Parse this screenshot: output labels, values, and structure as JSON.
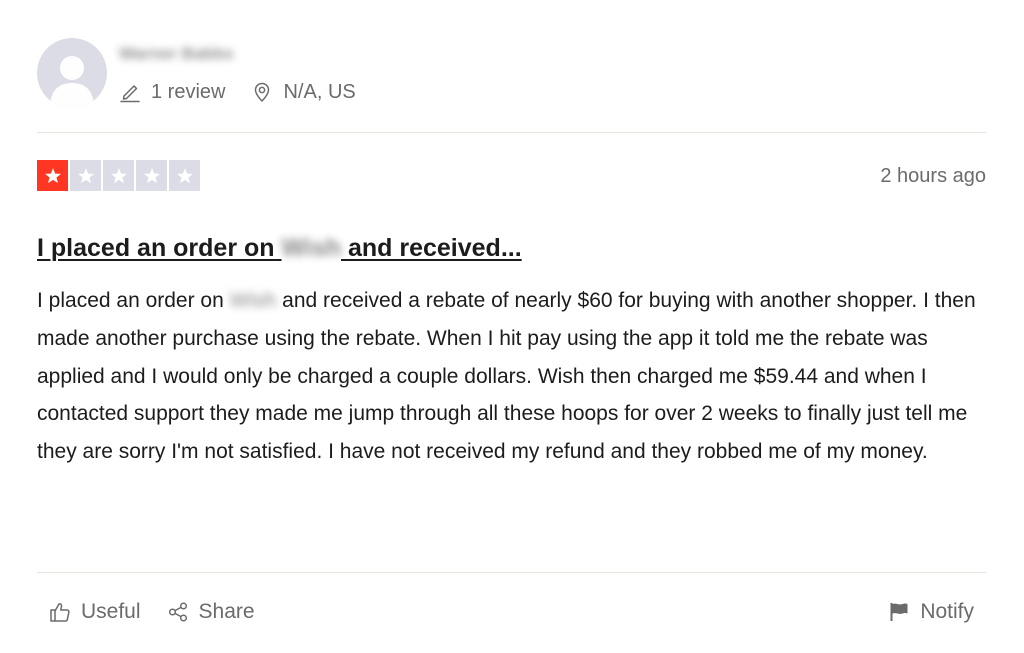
{
  "reviewer": {
    "name": "Warner Babbs",
    "review_count": "1 review",
    "location": "N/A, US"
  },
  "review": {
    "rating": 1,
    "max_rating": 5,
    "date": "2 hours ago",
    "title_prefix": "I placed an order on",
    "title_redacted": "Wish",
    "title_suffix": "and received...",
    "body_prefix": "I placed an order on",
    "body_redacted": "Wish",
    "body_suffix": "and received a rebate of nearly $60 for buying with another shopper. I then made another purchase using the rebate. When I hit pay using the app it told me the rebate was applied and I would only be charged a couple dollars. Wish then charged me $59.44 and when I contacted support they made me jump through all these hoops for over 2 weeks to finally just tell me they are sorry I'm not satisfied. I have not received my refund and they robbed me of my money."
  },
  "actions": {
    "useful_label": "Useful",
    "share_label": "Share",
    "notify_label": "Notify"
  },
  "colors": {
    "star_filled": "#ff3722",
    "star_empty": "#dcdce6",
    "text_primary": "#1c1c1c",
    "text_muted": "#6b6b6b"
  },
  "icons": {
    "avatar": "person-silhouette-icon",
    "review_count": "pencil-icon",
    "location": "location-pin-icon",
    "star": "star-icon",
    "useful": "thumbs-up-icon",
    "share": "share-icon",
    "notify": "flag-icon"
  }
}
